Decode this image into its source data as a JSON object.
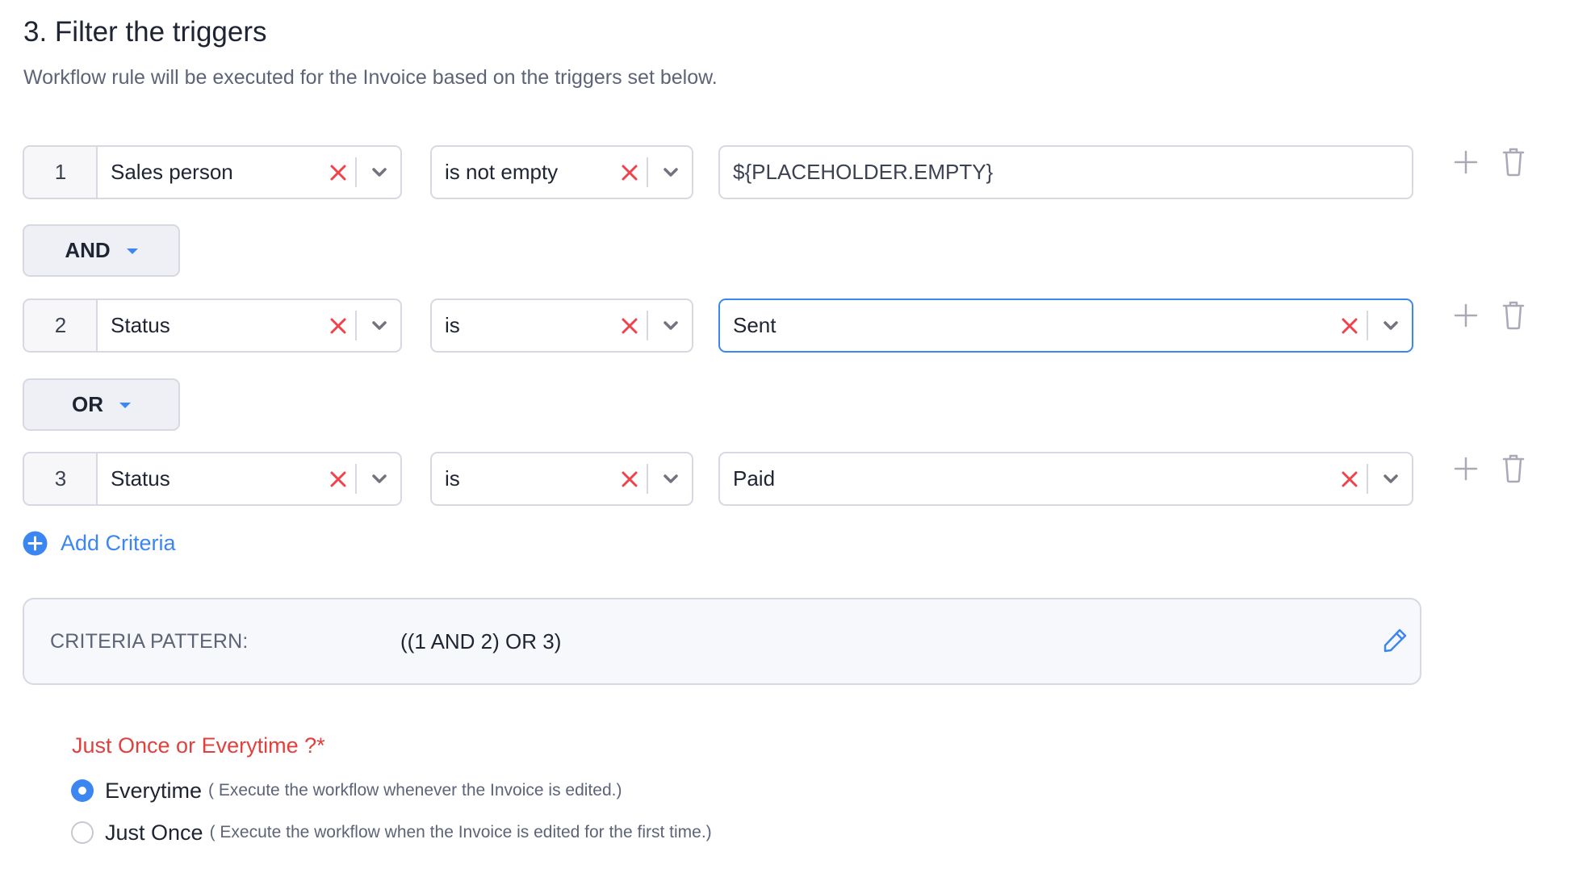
{
  "section": {
    "title": "3. Filter the triggers",
    "subtitle": "Workflow rule will be executed for the Invoice based on the triggers set below."
  },
  "criteria": [
    {
      "number": "1",
      "field": "Sales person",
      "operator": "is not empty",
      "value": "${PLACEHOLDER.EMPTY}",
      "value_type": "text",
      "focused": false
    },
    {
      "number": "2",
      "field": "Status",
      "operator": "is",
      "value": "Sent",
      "value_type": "select",
      "focused": true
    },
    {
      "number": "3",
      "field": "Status",
      "operator": "is",
      "value": "Paid",
      "value_type": "select",
      "focused": false
    }
  ],
  "connectors": [
    {
      "label": "AND"
    },
    {
      "label": "OR"
    }
  ],
  "add_criteria": {
    "label": "Add Criteria",
    "icon": "plus-circle-icon"
  },
  "criteria_pattern": {
    "label": "CRITERIA PATTERN:",
    "value": "((1 AND 2) OR 3)",
    "edit_icon": "pencil-icon"
  },
  "frequency": {
    "label": "Just Once or Everytime ?*",
    "selected": "Everytime",
    "options": [
      {
        "label": "Everytime",
        "hint": "( Execute the workflow whenever the Invoice is edited.)",
        "checked": true
      },
      {
        "label": "Just Once",
        "hint": "( Execute the workflow when the Invoice is edited for the first time.)",
        "checked": false
      }
    ]
  },
  "icons": {
    "clear": "x-icon",
    "dropdown": "chevron-down-icon",
    "add_row": "plus-icon",
    "delete_row": "trash-icon"
  },
  "colors": {
    "accent": "#3b86f0",
    "danger": "#f0424a",
    "required_label": "#e2403c",
    "border": "#d8d8e2",
    "muted_text": "#5d6477",
    "icon_gray": "#a9a9b8"
  }
}
